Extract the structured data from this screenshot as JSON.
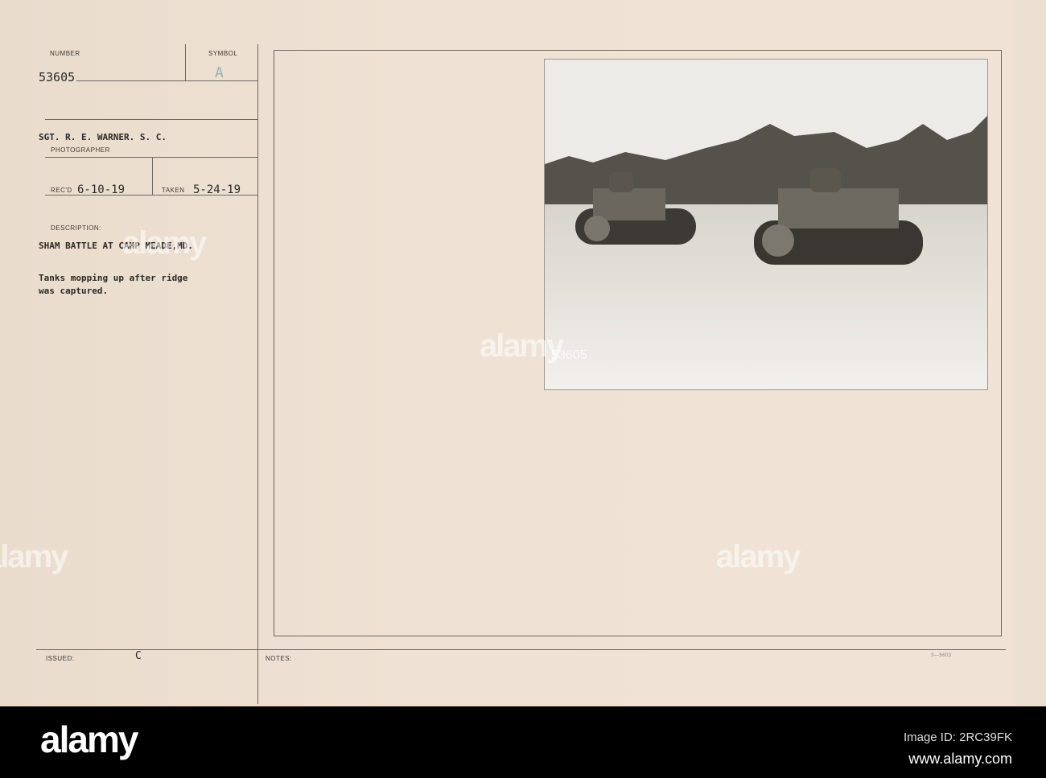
{
  "card": {
    "number_label": "NUMBER",
    "number": "53605",
    "symbol_label": "SYMBOL",
    "symbol": "A",
    "photographer": "SGT. R. E. WARNER. S. C.",
    "photographer_label": "PHOTOGRAPHER",
    "recd_label": "REC'D",
    "recd": "6-10-19",
    "taken_label": "TAKEN",
    "taken": "5-24-19",
    "description_label": "DESCRIPTION:",
    "title": "SHAM BATTLE AT CAMP MEADE,MD.",
    "description_line1": "Tanks mopping up after ridge",
    "description_line2": "was captured.",
    "issued_label": "ISSUED:",
    "issued": "C",
    "notes_label": "NOTES:",
    "form_code": "3—5603",
    "photo_number": "53605"
  },
  "watermark": "alamy",
  "footer": {
    "logo": "alamy",
    "image_id": "Image ID: 2RC39FK",
    "url": "www.alamy.com"
  }
}
